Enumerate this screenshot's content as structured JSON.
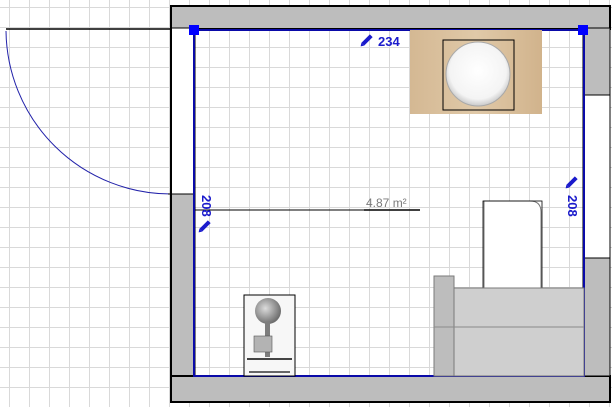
{
  "plan": {
    "room_area": "4.87 m²",
    "dimensions": {
      "top": "234",
      "left": "208",
      "right": "208"
    }
  },
  "colors": {
    "wall_fill": "#bdbdbd",
    "wall_outline": "#000000",
    "room_outline": "#0a0aa8",
    "selection_handle": "#0000ff",
    "dimension_text": "#1a1acc",
    "wood": "#d8bf9c",
    "background_grid": "#d9d9d9"
  },
  "furniture": [
    {
      "name": "washbasin",
      "icon": "round-sink-icon"
    },
    {
      "name": "toilet",
      "icon": "toilet-icon"
    },
    {
      "name": "bathtub",
      "icon": "bathtub-icon"
    },
    {
      "name": "shower",
      "icon": "shower-icon"
    },
    {
      "name": "door",
      "icon": "door-swing-icon"
    }
  ]
}
